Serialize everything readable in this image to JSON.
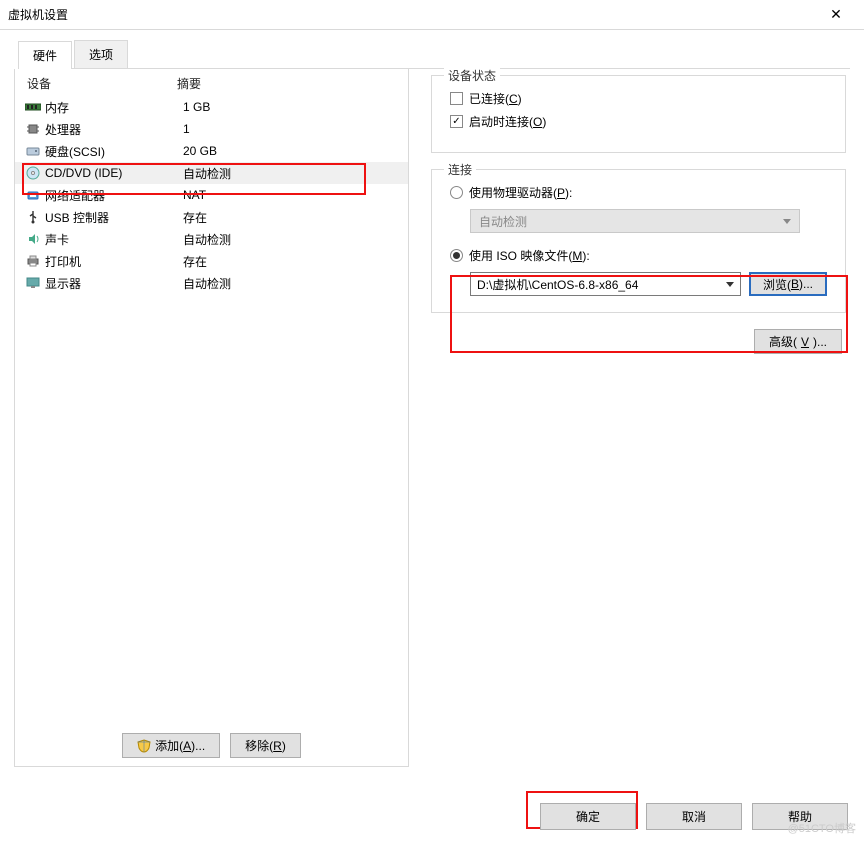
{
  "window": {
    "title": "虚拟机设置",
    "close": "✕"
  },
  "tabs": {
    "hardware": "硬件",
    "options": "选项"
  },
  "list": {
    "header_device": "设备",
    "header_summary": "摘要",
    "rows": [
      {
        "name": "内存",
        "summary": "1 GB"
      },
      {
        "name": "处理器",
        "summary": "1"
      },
      {
        "name": "硬盘(SCSI)",
        "summary": "20 GB"
      },
      {
        "name": "CD/DVD (IDE)",
        "summary": "自动检测"
      },
      {
        "name": "网络适配器",
        "summary": "NAT"
      },
      {
        "name": "USB 控制器",
        "summary": "存在"
      },
      {
        "name": "声卡",
        "summary": "自动检测"
      },
      {
        "name": "打印机",
        "summary": "存在"
      },
      {
        "name": "显示器",
        "summary": "自动检测"
      }
    ],
    "add": "添加(A)...",
    "remove": "移除(R)"
  },
  "status": {
    "legend": "设备状态",
    "connected": "已连接(C)",
    "connect_on_power": "启动时连接(O)"
  },
  "connection": {
    "legend": "连接",
    "use_physical": "使用物理驱动器(P):",
    "physical_value": "自动检测",
    "use_iso": "使用 ISO 映像文件(M):",
    "iso_path": "D:\\虚拟机\\CentOS-6.8-x86_64",
    "browse": "浏览(B)..."
  },
  "advanced": "高级(V)...",
  "footer": {
    "ok": "确定",
    "cancel": "取消",
    "help": "帮助"
  },
  "watermark": "@51CTO博客"
}
